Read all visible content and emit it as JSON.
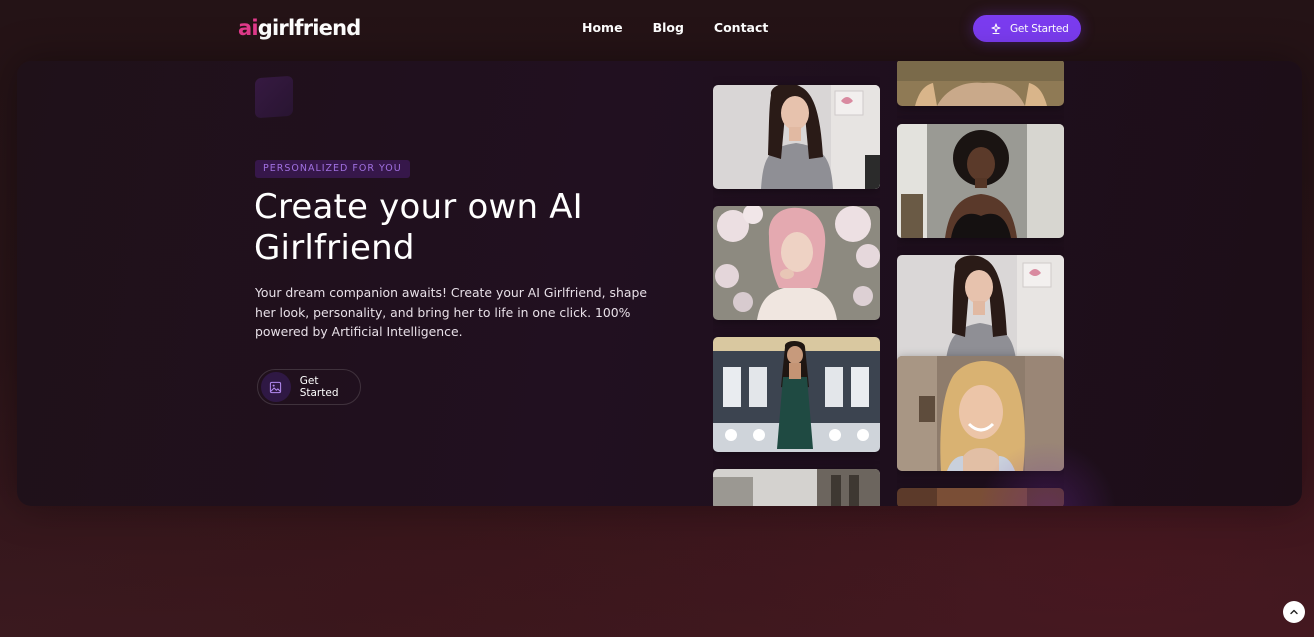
{
  "header": {
    "logo_ai": "ai",
    "logo_word": "girlfriend",
    "nav": [
      {
        "label": "Home"
      },
      {
        "label": "Blog"
      },
      {
        "label": "Contact"
      }
    ],
    "cta_label": "Get Started",
    "cta_icon": "sparkle-download-icon",
    "cta_color": "#7b3cf0"
  },
  "hero": {
    "badge": "PERSONALIZED FOR YOU",
    "title": "Create your own AI Girlfriend",
    "description": "Your dream companion awaits! Create your AI Girlfriend, shape her look, personality, and bring her to life in one click. 100% powered by Artificial Intelligence.",
    "cta_label": "Get Started",
    "cta_icon": "image-icon"
  },
  "gallery": {
    "column_a": [
      {
        "name": "portrait-gray-top-brunette"
      },
      {
        "name": "portrait-pink-hair-blossoms"
      },
      {
        "name": "portrait-green-dress-hall"
      },
      {
        "name": "portrait-partial-bottom"
      }
    ],
    "column_b": [
      {
        "name": "portrait-partial-top"
      },
      {
        "name": "portrait-curly-hair-black-top"
      },
      {
        "name": "portrait-gray-top-brunette-2"
      },
      {
        "name": "portrait-blonde-smile"
      },
      {
        "name": "portrait-partial-bottom-2"
      }
    ]
  },
  "colors": {
    "brand_pink": "#e23a8c",
    "accent_purple": "#7b3cf0",
    "badge_text": "#a070e0"
  },
  "scroll_top_icon": "chevron-up-icon"
}
